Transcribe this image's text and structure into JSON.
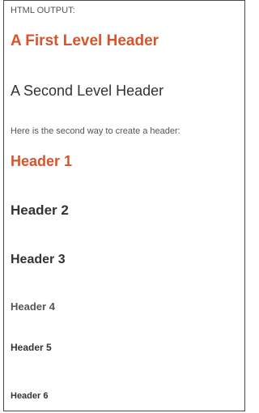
{
  "caption": "HTML OUTPUT:",
  "first_level_header": "A First Level Header",
  "second_level_header": "A Second Level Header",
  "intro_text": "Here is the second way to create a header:",
  "headers": {
    "h1": "Header 1",
    "h2": "Header 2",
    "h3": "Header 3",
    "h4": "Header 4",
    "h5": "Header 5",
    "h6": "Header 6"
  },
  "colors": {
    "accent": "#d9532b",
    "text": "#333333",
    "muted": "#555555",
    "border": "#4a4a4a"
  }
}
